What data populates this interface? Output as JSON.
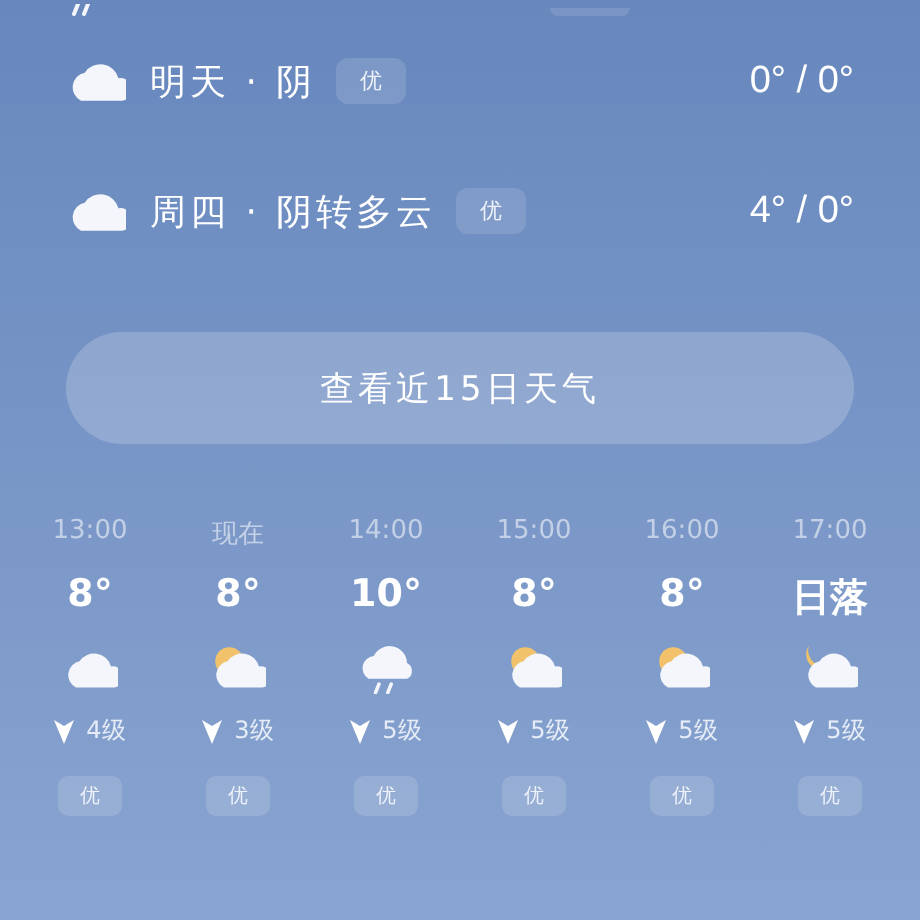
{
  "daily": [
    {
      "kind": "cloudy",
      "label": "明天 · 阴",
      "air_quality": "优",
      "temps": "0° / 0°"
    },
    {
      "kind": "cloudy",
      "label": "周四 · 阴转多云",
      "air_quality": "优",
      "temps": "4° / 0°"
    }
  ],
  "forecast_button": "查看近15日天气",
  "hourly": [
    {
      "time": "13:00",
      "temp": "8°",
      "kind": "cloudy",
      "wind": "4级",
      "air_quality": "优"
    },
    {
      "time": "现在",
      "temp": "8°",
      "kind": "partly-sunny",
      "wind": "3级",
      "air_quality": "优"
    },
    {
      "time": "14:00",
      "temp": "10°",
      "kind": "rain",
      "wind": "5级",
      "air_quality": "优"
    },
    {
      "time": "15:00",
      "temp": "8°",
      "kind": "partly-sunny",
      "wind": "5级",
      "air_quality": "优"
    },
    {
      "time": "16:00",
      "temp": "8°",
      "kind": "partly-sunny",
      "wind": "5级",
      "air_quality": "优"
    },
    {
      "time": "17:00",
      "temp": "日落",
      "kind": "moon-cloud",
      "wind": "5级",
      "air_quality": "优"
    }
  ]
}
